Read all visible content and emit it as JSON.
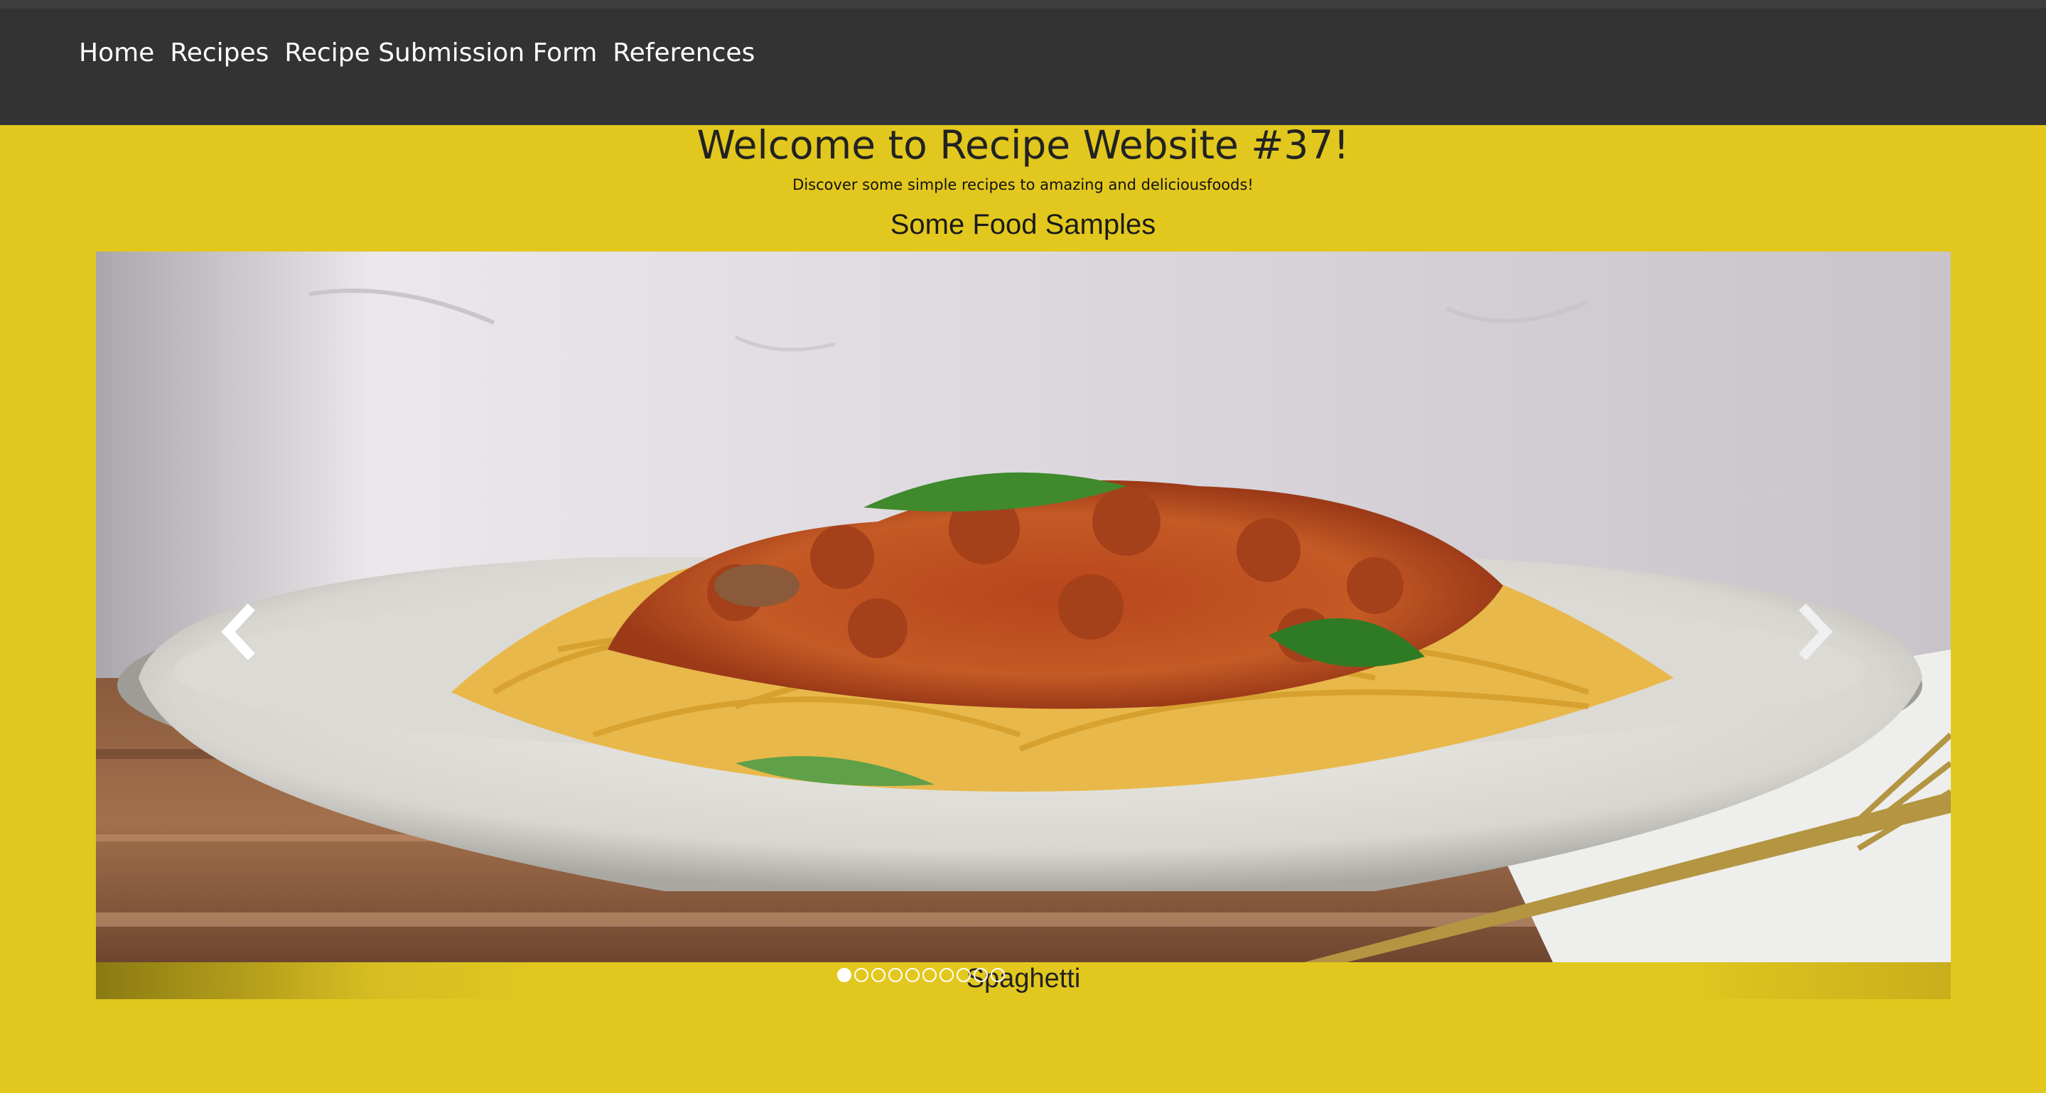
{
  "nav": {
    "items": [
      {
        "label": "Home"
      },
      {
        "label": "Recipes"
      },
      {
        "label": "Recipe Submission Form"
      },
      {
        "label": "References"
      }
    ]
  },
  "header": {
    "title": "Welcome to Recipe Website #37!",
    "subtitle": "Discover some simple recipes to amazing and deliciousfoods!"
  },
  "carousel": {
    "heading": "Some Food Samples",
    "caption": "Spaghetti",
    "slide_count": 10,
    "active_index": 0,
    "image_subject": "spaghetti bolognese in white bowl with basil and fork",
    "prev_icon": "chevron-left-icon",
    "next_icon": "chevron-right-icon"
  },
  "colors": {
    "page_background": "#e2c81e",
    "nav_background": "#333333",
    "nav_text": "#ffffff"
  }
}
